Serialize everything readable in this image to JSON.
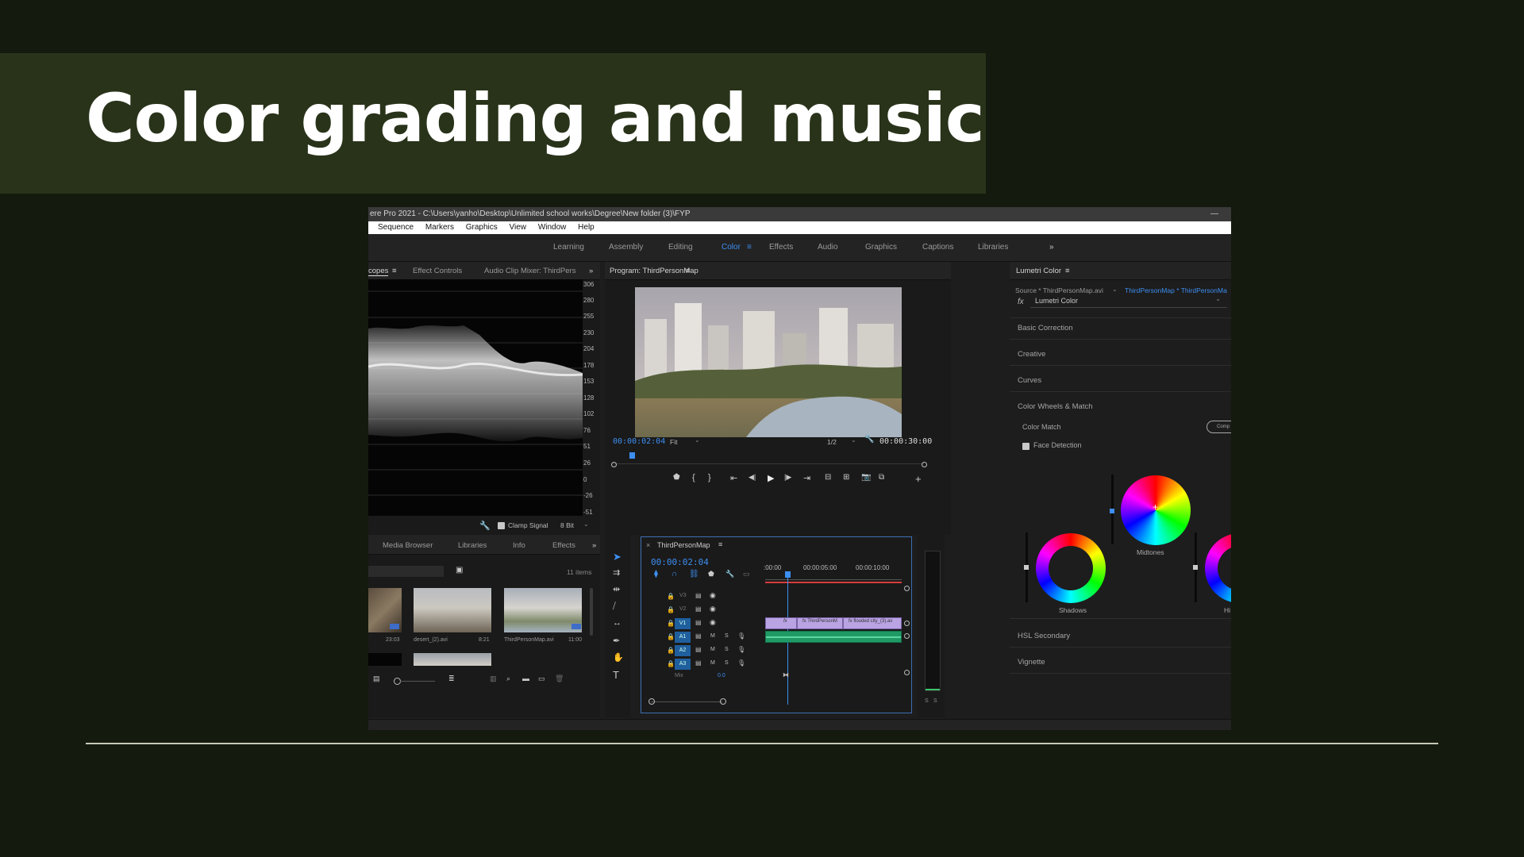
{
  "slide": {
    "title": "Color grading and music"
  },
  "app": {
    "window_title": "ere Pro 2021 - C:\\Users\\yanho\\Desktop\\Unlimited school works\\Degree\\New folder (3)\\FYP",
    "menu": [
      "Sequence",
      "Markers",
      "Graphics",
      "View",
      "Window",
      "Help"
    ],
    "workspaces": [
      "Learning",
      "Assembly",
      "Editing",
      "Color",
      "Effects",
      "Audio",
      "Graphics",
      "Captions",
      "Libraries"
    ],
    "active_workspace": "Color",
    "scopes": {
      "tabs": [
        "copes",
        "Effect Controls",
        "Audio Clip Mixer: ThirdPers"
      ],
      "scale": [
        "306",
        "280",
        "255",
        "230",
        "204",
        "178",
        "153",
        "128",
        "102",
        "76",
        "51",
        "26",
        "0",
        "-26",
        "-51"
      ],
      "clamp_label": "Clamp Signal",
      "bit_depth": "8 Bit"
    },
    "program": {
      "tab": "Program: ThirdPersonMap",
      "timecode": "00:00:02:04",
      "fit": "Fit",
      "resolution": "1/2",
      "duration": "00:00:30:00"
    },
    "project": {
      "tabs": [
        "Media Browser",
        "Libraries",
        "Info",
        "Effects"
      ],
      "item_count": "11 items",
      "items": [
        {
          "name": "",
          "duration": "23:03"
        },
        {
          "name": "desert_(2).avi",
          "duration": "8:21"
        },
        {
          "name": "ThirdPersonMap.avi",
          "duration": "11:00"
        }
      ]
    },
    "timeline": {
      "tab": "ThirdPersonMap",
      "timecode": "00:00:02:04",
      "ruler": [
        ":00:00",
        "00:00:05:00",
        "00:00:10:00"
      ],
      "video_tracks": [
        "V3",
        "V2",
        "V1"
      ],
      "audio_tracks": [
        "A1",
        "A2",
        "A3"
      ],
      "mix_label": "Mix",
      "mix_value": "0.0",
      "clips": [
        "fx",
        "fx  ThirdPersonM",
        "fx  flooded city_(3).av"
      ]
    },
    "lumetri": {
      "tab": "Lumetri Color",
      "source": "Source * ThirdPersonMap.avi",
      "sequence_link": "ThirdPersonMap * ThirdPersonMa",
      "effect": "Lumetri Color",
      "sections": [
        "Basic Correction",
        "Creative",
        "Curves",
        "Color Wheels & Match"
      ],
      "color_match": "Color Match",
      "compare_button": "Comp",
      "face_detection": "Face Detection",
      "wheels": [
        "Midtones",
        "Shadows",
        "Hi"
      ],
      "lower_sections": [
        "HSL Secondary",
        "Vignette"
      ]
    },
    "meter_labels": [
      "S",
      "S"
    ]
  }
}
